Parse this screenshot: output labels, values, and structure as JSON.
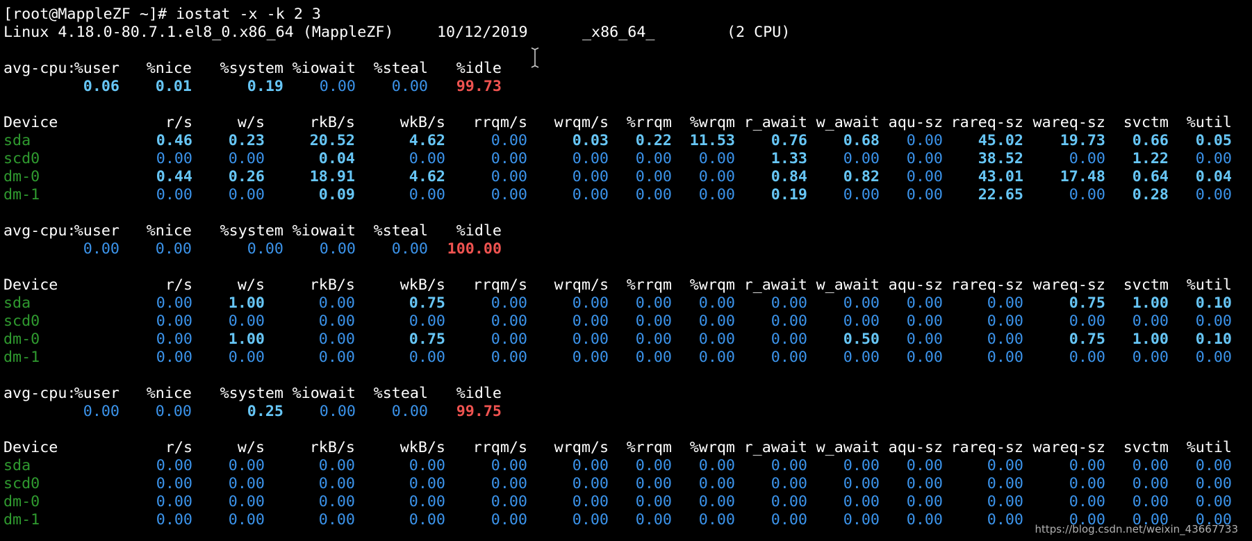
{
  "terminal": {
    "prompt_line": "[root@MappleZF ~]# iostat -x -k 2 3",
    "sys_info": {
      "kernel": "Linux 4.18.0-80.7.1.el8_0.x86_64 (MappleZF)",
      "date": "10/12/2019",
      "arch": "_x86_64_",
      "cpus": "(2 CPU)"
    },
    "cpu_label": "avg-cpu:",
    "cpu_headers": [
      "%user",
      "%nice",
      "%system",
      "%iowait",
      "%steal",
      "%idle"
    ],
    "device_headers": [
      "Device",
      "r/s",
      "w/s",
      "rkB/s",
      "wkB/s",
      "rrqm/s",
      "wrqm/s",
      "%rrqm",
      "%wrqm",
      "r_await",
      "w_await",
      "aqu-sz",
      "rareq-sz",
      "wareq-sz",
      "svctm",
      "%util"
    ],
    "reports": [
      {
        "cpu": [
          "0.06",
          "0.01",
          "0.19",
          "0.00",
          "0.00",
          "99.73"
        ],
        "devices": [
          {
            "name": "sda",
            "values": [
              "0.46",
              "0.23",
              "20.52",
              "4.62",
              "0.00",
              "0.03",
              "0.22",
              "11.53",
              "0.76",
              "0.68",
              "0.00",
              "45.02",
              "19.73",
              "0.66",
              "0.05"
            ]
          },
          {
            "name": "scd0",
            "values": [
              "0.00",
              "0.00",
              "0.04",
              "0.00",
              "0.00",
              "0.00",
              "0.00",
              "0.00",
              "1.33",
              "0.00",
              "0.00",
              "38.52",
              "0.00",
              "1.22",
              "0.00"
            ]
          },
          {
            "name": "dm-0",
            "values": [
              "0.44",
              "0.26",
              "18.91",
              "4.62",
              "0.00",
              "0.00",
              "0.00",
              "0.00",
              "0.84",
              "0.82",
              "0.00",
              "43.01",
              "17.48",
              "0.64",
              "0.04"
            ]
          },
          {
            "name": "dm-1",
            "values": [
              "0.00",
              "0.00",
              "0.09",
              "0.00",
              "0.00",
              "0.00",
              "0.00",
              "0.00",
              "0.19",
              "0.00",
              "0.00",
              "22.65",
              "0.00",
              "0.28",
              "0.00"
            ]
          }
        ]
      },
      {
        "cpu": [
          "0.00",
          "0.00",
          "0.00",
          "0.00",
          "0.00",
          "100.00"
        ],
        "devices": [
          {
            "name": "sda",
            "values": [
              "0.00",
              "1.00",
              "0.00",
              "0.75",
              "0.00",
              "0.00",
              "0.00",
              "0.00",
              "0.00",
              "0.00",
              "0.00",
              "0.00",
              "0.75",
              "1.00",
              "0.10"
            ]
          },
          {
            "name": "scd0",
            "values": [
              "0.00",
              "0.00",
              "0.00",
              "0.00",
              "0.00",
              "0.00",
              "0.00",
              "0.00",
              "0.00",
              "0.00",
              "0.00",
              "0.00",
              "0.00",
              "0.00",
              "0.00"
            ]
          },
          {
            "name": "dm-0",
            "values": [
              "0.00",
              "1.00",
              "0.00",
              "0.75",
              "0.00",
              "0.00",
              "0.00",
              "0.00",
              "0.00",
              "0.50",
              "0.00",
              "0.00",
              "0.75",
              "1.00",
              "0.10"
            ]
          },
          {
            "name": "dm-1",
            "values": [
              "0.00",
              "0.00",
              "0.00",
              "0.00",
              "0.00",
              "0.00",
              "0.00",
              "0.00",
              "0.00",
              "0.00",
              "0.00",
              "0.00",
              "0.00",
              "0.00",
              "0.00"
            ]
          }
        ]
      },
      {
        "cpu": [
          "0.00",
          "0.00",
          "0.25",
          "0.00",
          "0.00",
          "99.75"
        ],
        "devices": [
          {
            "name": "sda",
            "values": [
              "0.00",
              "0.00",
              "0.00",
              "0.00",
              "0.00",
              "0.00",
              "0.00",
              "0.00",
              "0.00",
              "0.00",
              "0.00",
              "0.00",
              "0.00",
              "0.00",
              "0.00"
            ]
          },
          {
            "name": "scd0",
            "values": [
              "0.00",
              "0.00",
              "0.00",
              "0.00",
              "0.00",
              "0.00",
              "0.00",
              "0.00",
              "0.00",
              "0.00",
              "0.00",
              "0.00",
              "0.00",
              "0.00",
              "0.00"
            ]
          },
          {
            "name": "dm-0",
            "values": [
              "0.00",
              "0.00",
              "0.00",
              "0.00",
              "0.00",
              "0.00",
              "0.00",
              "0.00",
              "0.00",
              "0.00",
              "0.00",
              "0.00",
              "0.00",
              "0.00",
              "0.00"
            ]
          },
          {
            "name": "dm-1",
            "values": [
              "0.00",
              "0.00",
              "0.00",
              "0.00",
              "0.00",
              "0.00",
              "0.00",
              "0.00",
              "0.00",
              "0.00",
              "0.00",
              "0.00",
              "0.00",
              "0.00",
              "0.00"
            ]
          }
        ]
      }
    ]
  },
  "watermark": "https://blog.csdn.net/weixin_43667733",
  "colors": {
    "background": "#000000",
    "text": "#ffffff",
    "zero_value": "#3b93ea",
    "nonzero_value": "#67c6f6",
    "idle_value": "#ef5350",
    "device_name": "#2f9a2f"
  },
  "icons": {
    "cursor": "text-cursor-icon"
  }
}
